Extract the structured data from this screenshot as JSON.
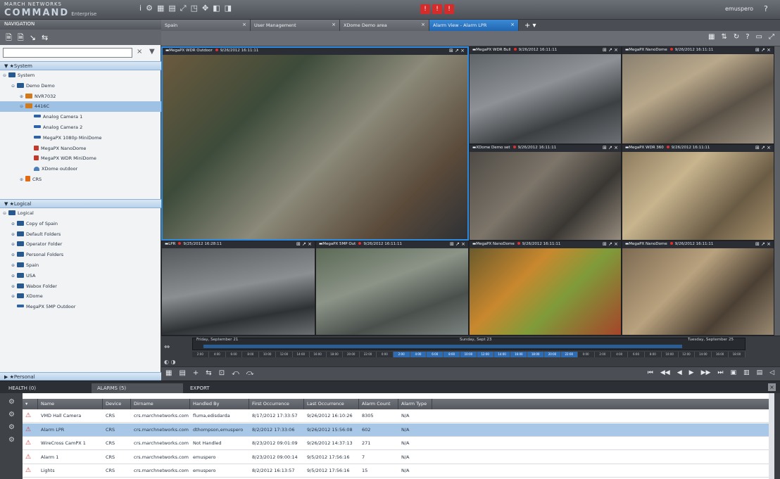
{
  "app": {
    "brand_line1": "MARCH NETWORKS",
    "brand_line2": "COMMAND",
    "brand_sub": "Enterprise",
    "user": "emuspero",
    "help_glyph": "?",
    "toolbar_glyphs": [
      "i",
      "⚙",
      "▦",
      "▤",
      "⤢",
      "◳",
      "✥",
      "◧",
      "◨"
    ],
    "alarm_glyphs": [
      "!",
      "!",
      "!"
    ]
  },
  "nav": {
    "title": "NAVIGATION",
    "tool_glyphs": [
      "🗎",
      "🗎",
      "↘",
      "⇆"
    ],
    "search_placeholder": "",
    "clear_glyph": "×",
    "filter_glyph": "▼",
    "system_section": "System",
    "system_tree": [
      {
        "label": "System",
        "level": 0,
        "icon": "fld",
        "twisty": "⊖"
      },
      {
        "label": "Demo Demo",
        "level": 1,
        "icon": "fld",
        "twisty": "⊖"
      },
      {
        "label": "NVR7032",
        "level": 2,
        "icon": "nvr",
        "twisty": "⊕"
      },
      {
        "label": "4416C",
        "level": 2,
        "icon": "nvr",
        "twisty": "⊖",
        "selected": true
      },
      {
        "label": "Analog Camera 1",
        "level": 3,
        "icon": "cam",
        "twisty": ""
      },
      {
        "label": "Analog Camera 2",
        "level": 3,
        "icon": "cam",
        "twisty": ""
      },
      {
        "label": "MegaPX 1080p MiniDome",
        "level": 3,
        "icon": "cam",
        "twisty": ""
      },
      {
        "label": "MegaPX NanoDome",
        "level": 3,
        "icon": "ptz",
        "twisty": ""
      },
      {
        "label": "MegaPX WDR MiniDome",
        "level": 3,
        "icon": "ptz",
        "twisty": ""
      },
      {
        "label": "XDome outdoor",
        "level": 3,
        "icon": "dome",
        "twisty": ""
      },
      {
        "label": "CRS",
        "level": 2,
        "icon": "crs",
        "twisty": "⊕"
      }
    ],
    "logical_section": "Logical",
    "logical_tree": [
      {
        "label": "Logical",
        "level": 0,
        "icon": "fld",
        "twisty": "⊖"
      },
      {
        "label": "Copy of Spain",
        "level": 1,
        "icon": "fld",
        "twisty": "⊕"
      },
      {
        "label": "Default Folders",
        "level": 1,
        "icon": "fld",
        "twisty": "⊕"
      },
      {
        "label": "Operator Folder",
        "level": 1,
        "icon": "fld",
        "twisty": "⊕"
      },
      {
        "label": "Personal Folders",
        "level": 1,
        "icon": "fld",
        "twisty": "⊕"
      },
      {
        "label": "Spain",
        "level": 1,
        "icon": "fld",
        "twisty": "⊕"
      },
      {
        "label": "USA",
        "level": 1,
        "icon": "fld",
        "twisty": "⊕"
      },
      {
        "label": "Wabox Folder",
        "level": 1,
        "icon": "fld",
        "twisty": "⊕"
      },
      {
        "label": "XDome",
        "level": 1,
        "icon": "fld",
        "twisty": "⊕"
      },
      {
        "label": "MegaPX 5MP Outdoor",
        "level": 1,
        "icon": "cam",
        "twisty": ""
      }
    ],
    "personal_section": "Personal"
  },
  "tabs": [
    {
      "label": "Spain",
      "active": false
    },
    {
      "label": "User Management",
      "active": false
    },
    {
      "label": "XDome Demo area",
      "active": false
    },
    {
      "label": "Alarm View - Alarm LPR",
      "active": true
    }
  ],
  "view_icons": [
    "▦",
    "⇅",
    "↻",
    "?",
    "▭",
    "⤢"
  ],
  "tiles": [
    {
      "name": "MegaPX WDR Outdoor",
      "time": "9/26/2012 16:11:11",
      "big": true
    },
    {
      "name": "MegaPX WDR Bull",
      "time": "9/26/2012 16:11:11"
    },
    {
      "name": "MegaPX NanoDome",
      "time": "9/26/2012 16:11:11"
    },
    {
      "name": "XDome Demo set",
      "time": "9/26/2012 16:11:11"
    },
    {
      "name": "MegaPX WDR 360",
      "time": "9/26/2012 16:11:11"
    },
    {
      "name": "LPR",
      "time": "9/25/2012 16:28:11"
    },
    {
      "name": "MegaPX 5MP Out",
      "time": "9/26/2012 16:11:11"
    },
    {
      "name": "MegaPX NanoDome",
      "time": "9/26/2012 16:11:11"
    },
    {
      "name": "MegaPX NanoDome",
      "time": "9/26/2012 16:11:11"
    }
  ],
  "timeline": {
    "start_label": "Friday, September 21",
    "mid_label": "Sunday, Sept 23",
    "end_label": "Tuesday, September 25",
    "ticks": [
      "2:00",
      "4:00",
      "6:00",
      "8:00",
      "10:00",
      "12:00",
      "14:00",
      "16:00",
      "18:00",
      "20:00",
      "22:00",
      "0:00",
      "2:00",
      "4:00",
      "6:00",
      "8:00",
      "10:00",
      "12:00",
      "14:00",
      "16:00",
      "18:00",
      "20:00",
      "22:00",
      "0:00",
      "2:00",
      "4:00",
      "6:00",
      "8:00",
      "10:00",
      "12:00",
      "14:00",
      "16:00",
      "18:00"
    ],
    "highlight_from": 12,
    "highlight_to": 22
  },
  "player": {
    "left_glyphs": [
      "▦",
      "▤",
      "+",
      "⇆",
      "⊡",
      "⤺",
      "⤼"
    ],
    "right_glyphs": [
      "⏮",
      "◀◀",
      "◀",
      "▶",
      "▶▶",
      "⏭",
      "▣",
      "▥",
      "▤",
      "◁"
    ]
  },
  "bottom": {
    "tabs": [
      "HEALTH (0)",
      "ALARMS (5)",
      "EXPORT"
    ],
    "close_glyph": "×",
    "side_glyphs": [
      "⚙",
      "⚙",
      "⚙",
      "⚙"
    ],
    "columns": [
      "Name",
      "Device",
      "Dirname",
      "Handled By",
      "First Occurrence",
      "Last Occurrence",
      "Alarm Count",
      "Alarm Type"
    ],
    "rows": [
      [
        "VMD Hall Camera",
        "CRS",
        "crs.marchnetworks.com",
        "fluma,edisdarda",
        "8/17/2012 17:33:57",
        "9/26/2012 16:10:26",
        "8305",
        "N/A"
      ],
      [
        "Alarm LPR",
        "CRS",
        "crs.marchnetworks.com",
        "dthompson,emuspero",
        "8/2/2012 17:33:06",
        "9/26/2012 15:56:08",
        "602",
        "N/A"
      ],
      [
        "WireCross CamPX 1",
        "CRS",
        "crs.marchnetworks.com",
        "Not Handled",
        "8/23/2012 09:01:09",
        "9/26/2012 14:37:13",
        "271",
        "N/A"
      ],
      [
        "Alarm 1",
        "CRS",
        "crs.marchnetworks.com",
        "emuspero",
        "8/23/2012 09:00:14",
        "9/5/2012 17:56:16",
        "7",
        "N/A"
      ],
      [
        "Lights",
        "CRS",
        "crs.marchnetworks.com",
        "emuspero",
        "8/2/2012 16:13:57",
        "9/5/2012 17:56:16",
        "15",
        "N/A"
      ]
    ],
    "selected_row": 1
  },
  "colors": {
    "accent": "#2f8be0",
    "alarm_red": "#d42b2b",
    "selection": "#a9c8e8"
  }
}
